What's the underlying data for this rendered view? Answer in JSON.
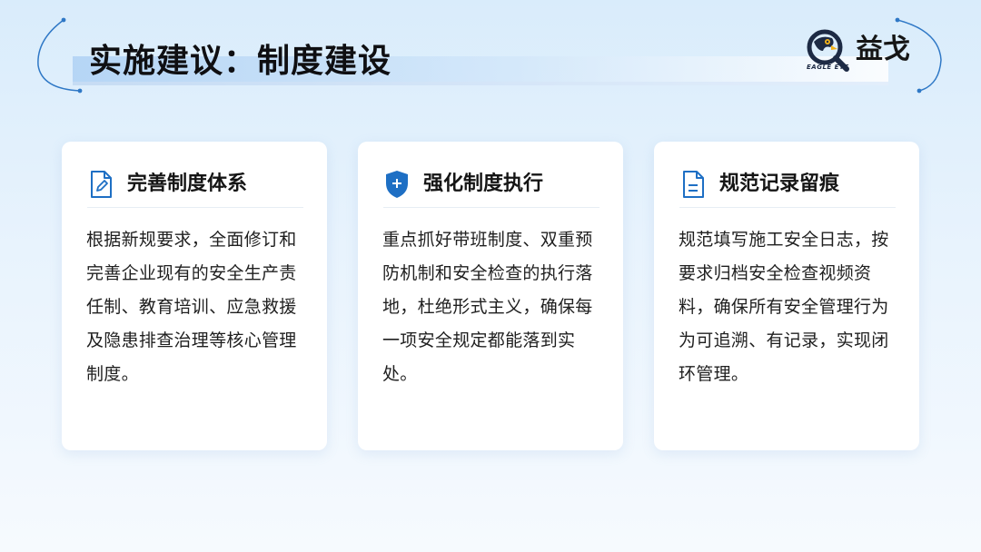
{
  "header": {
    "title": "实施建议：制度建设"
  },
  "brand": {
    "name": "益戈",
    "subtitle": "EAGLE EYE",
    "icon": "eagle-eye-logo"
  },
  "cards": [
    {
      "icon": "document-edit-icon",
      "title": "完善制度体系",
      "body": "根据新规要求，全面修订和完善企业现有的安全生产责任制、教育培训、应急救援及隐患排查治理等核心管理制度。"
    },
    {
      "icon": "shield-plus-icon",
      "title": "强化制度执行",
      "body": "重点抓好带班制度、双重预防机制和安全检查的执行落地，杜绝形式主义，确保每一项安全规定都能落到实处。"
    },
    {
      "icon": "document-lines-icon",
      "title": "规范记录留痕",
      "body": "规范填写施工安全日志，按要求归档安全检查视频资料，确保所有安全管理行为为可追溯、有记录，实现闭环管理。"
    }
  ],
  "colors": {
    "accent": "#1e6fc4",
    "background_top": "#d9ecfb",
    "card": "#ffffff"
  }
}
